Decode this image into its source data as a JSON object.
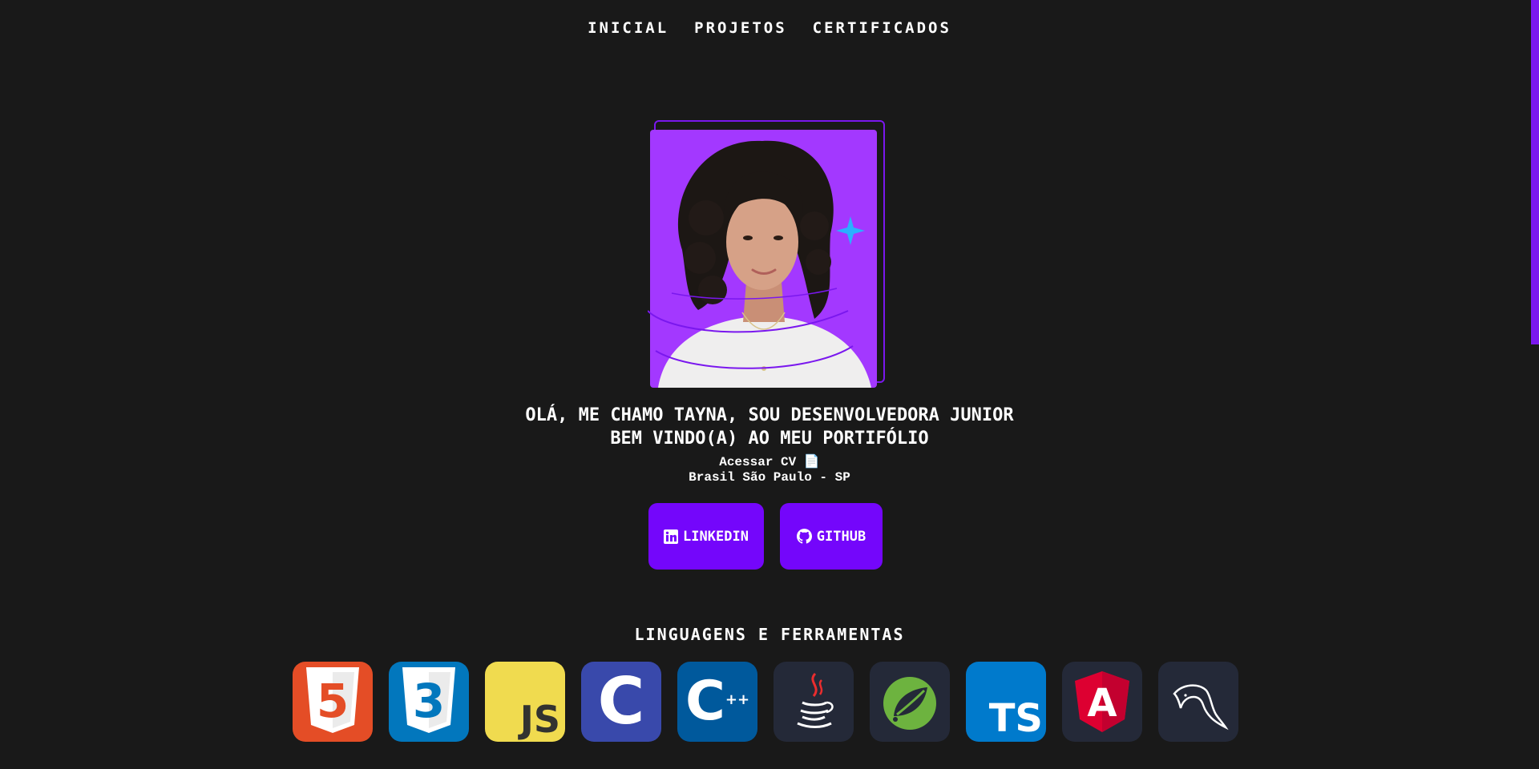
{
  "nav": {
    "items": [
      {
        "label": "INICIAL"
      },
      {
        "label": "PROJETOS"
      },
      {
        "label": "CERTIFICADOS"
      }
    ]
  },
  "hero": {
    "title_line1": "OLÁ, ME CHAMO TAYNA, SOU DESENVOLVEDORA JUNIOR",
    "title_line2": "BEM VINDO(A) AO MEU PORTIFÓLIO",
    "cv_label": "Acessar CV 📄",
    "location": "Brasil São Paulo - SP"
  },
  "social": {
    "linkedin_label": "LINKEDIN",
    "github_label": "GITHUB"
  },
  "skills": {
    "title": "LINGUAGENS E FERRAMENTAS",
    "icons": [
      {
        "name": "html5-icon",
        "text": "5"
      },
      {
        "name": "css3-icon",
        "text": "3"
      },
      {
        "name": "javascript-icon",
        "text": "JS"
      },
      {
        "name": "c-icon",
        "text": "C"
      },
      {
        "name": "cplusplus-icon",
        "text": "C",
        "sup": "++"
      },
      {
        "name": "java-icon"
      },
      {
        "name": "spring-icon"
      },
      {
        "name": "typescript-icon",
        "text": "TS"
      },
      {
        "name": "angular-icon",
        "text": "A"
      },
      {
        "name": "mysql-icon"
      }
    ]
  },
  "colors": {
    "background": "#191919",
    "accent": "#7406fb",
    "photo_bg": "#a338ff",
    "html5": "#e44d26",
    "css3": "#0277bd",
    "javascript": "#f0db4f",
    "c": "#3949ab",
    "cplusplus": "#00599c",
    "dark_tile": "#242938",
    "typescript": "#007acc",
    "angular": "#dd0031",
    "spring": "#6db33f"
  }
}
